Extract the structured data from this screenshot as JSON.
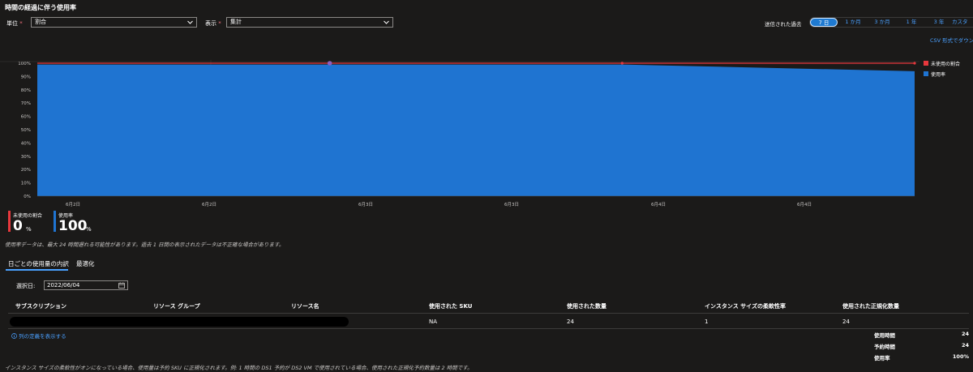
{
  "title": "時間の経過に伴う使用率",
  "filters": {
    "unit_label": "単位",
    "unit_value": "割合",
    "display_label": "表示",
    "display_value": "集計",
    "required_mark": "*"
  },
  "period": {
    "label": "送信された過去",
    "options": [
      "7 日",
      "1 か月",
      "3 か月",
      "1 年",
      "3 年",
      "カスタ"
    ],
    "selected": "7 日"
  },
  "csv_download": "CSV 形式でダウン",
  "chart_data": {
    "type": "area",
    "x_tick_labels": [
      "6月2日",
      "6月2日",
      "6月3日",
      "6月3日",
      "6月4日",
      "6月4日"
    ],
    "y_tick_labels": [
      "100%",
      "90%",
      "80%",
      "70%",
      "60%",
      "50%",
      "40%",
      "30%",
      "20%",
      "10%",
      "0%"
    ],
    "ylim": [
      0,
      100
    ],
    "x": [
      0,
      1,
      2,
      3
    ],
    "series": [
      {
        "name": "未使用の割合",
        "color": "#e8383d",
        "values": [
          100,
          100,
          100,
          100
        ]
      },
      {
        "name": "使用率",
        "color": "#1f74d1",
        "values": [
          99,
          99,
          99,
          94
        ]
      }
    ],
    "markers": [
      {
        "series": "未使用の割合",
        "x": 1,
        "y": 100
      },
      {
        "series": "未使用の割合",
        "x": 2,
        "y": 100
      },
      {
        "series": "未使用の割合",
        "x": 3,
        "y": 100
      }
    ]
  },
  "kpis": [
    {
      "label": "未使用の割合",
      "value": "0",
      "unit": "%",
      "color": "#e8383d"
    },
    {
      "label": "使用率",
      "value": "100",
      "unit": "%",
      "color": "#1f74d1"
    }
  ],
  "note_top": "使用率データは、最大 24 時間遅れる可能性があります。過去 1 日間の表示されたデータは不正確な場合があります。",
  "tabs": {
    "daily": "日ごとの使用量の内訳",
    "optimize": "最適化"
  },
  "date_filter": {
    "label": "選択日:",
    "value": "2022/06/04"
  },
  "table": {
    "columns": [
      "サブスクリプション",
      "リソース グループ",
      "リソース名",
      "使用された SKU",
      "使用された数量",
      "インスタンス サイズの柔軟性率",
      "使用された正規化数量"
    ],
    "rows": [
      {
        "sku": "NA",
        "quantity": "24",
        "flex_ratio": "1",
        "normalized": "24"
      }
    ]
  },
  "show_column_defs": "列の定義を表示する",
  "summary": [
    {
      "label": "使用時間",
      "value": "24"
    },
    {
      "label": "予約時間",
      "value": "24"
    },
    {
      "label": "使用率",
      "value": "100%"
    }
  ],
  "note_bottom": "インスタンス サイズの柔軟性がオンになっている場合、使用量は予約 SKU に正規化されます。例: 1 時間の DS1 予約が DS2 VM で使用されている場合、使用された正規化予約数量は 2 時間です。"
}
